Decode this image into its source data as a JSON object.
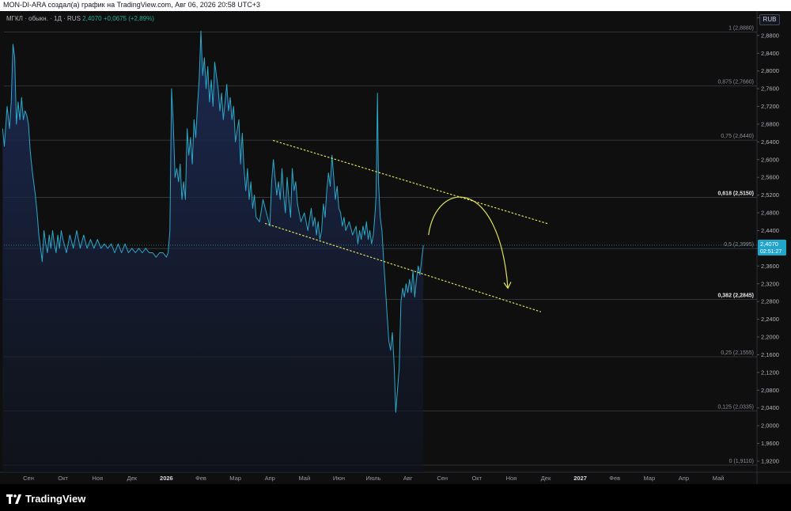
{
  "header": {
    "text": "MON-DI-ARA создал(а) график на TradingView.com, Авг 06, 2026 20:58 UTC+3"
  },
  "legend": {
    "symbol": "МГКЛ · обыкн. · 1Д · RUS",
    "price": "2,4070",
    "change": "+0,0675 (+2,89%)"
  },
  "currency": "RUB",
  "brand": {
    "logo_icon": "tradingview-logo-icon",
    "name": "TradingView"
  },
  "chart_data": {
    "type": "area",
    "title": "",
    "xlabel": "",
    "ylabel": "",
    "ylim": [
      1.895,
      2.935
    ],
    "price_tag": {
      "value": "2,4070",
      "countdown": "02:51:27",
      "y": 2.407
    },
    "y_ticks": [
      "1,9200",
      "1,9600",
      "2,0000",
      "2,0400",
      "2,0800",
      "2,1200",
      "2,1600",
      "2,2000",
      "2,2400",
      "2,2800",
      "2,3200",
      "2,3600",
      "2,4000",
      "2,4400",
      "2,4800",
      "2,5200",
      "2,5600",
      "2,6000",
      "2,6400",
      "2,6800",
      "2,7200",
      "2,7600",
      "2,8000",
      "2,8400",
      "2,8800",
      "2,9200"
    ],
    "y_tick_values": [
      1.92,
      1.96,
      2.0,
      2.04,
      2.08,
      2.12,
      2.16,
      2.2,
      2.24,
      2.28,
      2.32,
      2.36,
      2.4,
      2.44,
      2.48,
      2.52,
      2.56,
      2.6,
      2.64,
      2.68,
      2.72,
      2.76,
      2.8,
      2.84,
      2.88,
      2.92
    ],
    "x_ticks": [
      {
        "label": "Сен",
        "m": 0
      },
      {
        "label": "Окт",
        "m": 1
      },
      {
        "label": "Ноя",
        "m": 2
      },
      {
        "label": "Дек",
        "m": 3
      },
      {
        "label": "2026",
        "m": 4
      },
      {
        "label": "Фев",
        "m": 5
      },
      {
        "label": "Мар",
        "m": 6
      },
      {
        "label": "Апр",
        "m": 7
      },
      {
        "label": "Май",
        "m": 8
      },
      {
        "label": "Июн",
        "m": 9
      },
      {
        "label": "Июль",
        "m": 10
      },
      {
        "label": "Авг",
        "m": 11
      },
      {
        "label": "Сен",
        "m": 12
      },
      {
        "label": "Окт",
        "m": 13
      },
      {
        "label": "Ноя",
        "m": 14
      },
      {
        "label": "Дек",
        "m": 15
      },
      {
        "label": "2027",
        "m": 16
      },
      {
        "label": "Фев",
        "m": 17
      },
      {
        "label": "Мар",
        "m": 18
      },
      {
        "label": "Апр",
        "m": 19
      },
      {
        "label": "Май",
        "m": 20
      }
    ],
    "fib_levels": [
      {
        "label": "1 (2,8880)",
        "value": 2.888,
        "bold": false
      },
      {
        "label": "0,875 (2,7660)",
        "value": 2.766,
        "bold": false
      },
      {
        "label": "0,75 (2,6440)",
        "value": 2.644,
        "bold": false
      },
      {
        "label": "0,618 (2,5150)",
        "value": 2.515,
        "bold": true
      },
      {
        "label": "0,5 (2,3995)",
        "value": 2.3995,
        "bold": false
      },
      {
        "label": "0,382 (2,2845)",
        "value": 2.2845,
        "bold": true
      },
      {
        "label": "0,25 (2,1555)",
        "value": 2.1555,
        "bold": false
      },
      {
        "label": "0,125 (2,0335)",
        "value": 2.0335,
        "bold": false
      },
      {
        "label": "0 (1,9110)",
        "value": 1.911,
        "bold": false
      }
    ],
    "series": [
      {
        "color": "#2ca8c9",
        "points": [
          [
            -0.75,
            2.67
          ],
          [
            -0.7,
            2.63
          ],
          [
            -0.62,
            2.72
          ],
          [
            -0.55,
            2.67
          ],
          [
            -0.5,
            2.73
          ],
          [
            -0.45,
            2.86
          ],
          [
            -0.4,
            2.83
          ],
          [
            -0.35,
            2.68
          ],
          [
            -0.3,
            2.73
          ],
          [
            -0.25,
            2.69
          ],
          [
            -0.2,
            2.74
          ],
          [
            -0.15,
            2.69
          ],
          [
            -0.1,
            2.71
          ],
          [
            -0.05,
            2.7
          ],
          [
            0.0,
            2.68
          ],
          [
            0.05,
            2.62
          ],
          [
            0.1,
            2.58
          ],
          [
            0.15,
            2.55
          ],
          [
            0.2,
            2.52
          ],
          [
            0.25,
            2.48
          ],
          [
            0.3,
            2.43
          ],
          [
            0.35,
            2.4
          ],
          [
            0.4,
            2.37
          ],
          [
            0.45,
            2.44
          ],
          [
            0.5,
            2.41
          ],
          [
            0.55,
            2.39
          ],
          [
            0.6,
            2.43
          ],
          [
            0.65,
            2.4
          ],
          [
            0.7,
            2.44
          ],
          [
            0.75,
            2.41
          ],
          [
            0.8,
            2.39
          ],
          [
            0.85,
            2.43
          ],
          [
            0.9,
            2.4
          ],
          [
            0.95,
            2.44
          ],
          [
            1.0,
            2.42
          ],
          [
            1.1,
            2.39
          ],
          [
            1.2,
            2.43
          ],
          [
            1.3,
            2.4
          ],
          [
            1.4,
            2.44
          ],
          [
            1.5,
            2.4
          ],
          [
            1.6,
            2.43
          ],
          [
            1.7,
            2.4
          ],
          [
            1.8,
            2.42
          ],
          [
            1.9,
            2.4
          ],
          [
            2.0,
            2.42
          ],
          [
            2.1,
            2.4
          ],
          [
            2.2,
            2.41
          ],
          [
            2.3,
            2.4
          ],
          [
            2.4,
            2.41
          ],
          [
            2.5,
            2.39
          ],
          [
            2.6,
            2.41
          ],
          [
            2.7,
            2.39
          ],
          [
            2.8,
            2.41
          ],
          [
            2.9,
            2.39
          ],
          [
            3.0,
            2.4
          ],
          [
            3.1,
            2.39
          ],
          [
            3.2,
            2.4
          ],
          [
            3.3,
            2.39
          ],
          [
            3.4,
            2.4
          ],
          [
            3.5,
            2.39
          ],
          [
            3.6,
            2.39
          ],
          [
            3.7,
            2.38
          ],
          [
            3.8,
            2.39
          ],
          [
            3.9,
            2.39
          ],
          [
            4.0,
            2.38
          ],
          [
            4.05,
            2.39
          ],
          [
            4.1,
            2.44
          ],
          [
            4.15,
            2.76
          ],
          [
            4.2,
            2.68
          ],
          [
            4.25,
            2.56
          ],
          [
            4.3,
            2.58
          ],
          [
            4.35,
            2.55
          ],
          [
            4.4,
            2.59
          ],
          [
            4.45,
            2.51
          ],
          [
            4.5,
            2.55
          ],
          [
            4.55,
            2.51
          ],
          [
            4.6,
            2.67
          ],
          [
            4.65,
            2.61
          ],
          [
            4.7,
            2.65
          ],
          [
            4.75,
            2.59
          ],
          [
            4.8,
            2.69
          ],
          [
            4.85,
            2.65
          ],
          [
            4.9,
            2.72
          ],
          [
            4.95,
            2.78
          ],
          [
            5.0,
            2.89
          ],
          [
            5.05,
            2.79
          ],
          [
            5.1,
            2.83
          ],
          [
            5.15,
            2.76
          ],
          [
            5.2,
            2.81
          ],
          [
            5.25,
            2.73
          ],
          [
            5.3,
            2.78
          ],
          [
            5.35,
            2.72
          ],
          [
            5.4,
            2.82
          ],
          [
            5.45,
            2.79
          ],
          [
            5.5,
            2.76
          ],
          [
            5.55,
            2.71
          ],
          [
            5.6,
            2.75
          ],
          [
            5.65,
            2.69
          ],
          [
            5.7,
            2.73
          ],
          [
            5.75,
            2.77
          ],
          [
            5.8,
            2.71
          ],
          [
            5.85,
            2.74
          ],
          [
            5.9,
            2.69
          ],
          [
            5.95,
            2.72
          ],
          [
            6.0,
            2.64
          ],
          [
            6.1,
            2.69
          ],
          [
            6.15,
            2.59
          ],
          [
            6.2,
            2.66
          ],
          [
            6.25,
            2.58
          ],
          [
            6.3,
            2.53
          ],
          [
            6.35,
            2.58
          ],
          [
            6.4,
            2.51
          ],
          [
            6.45,
            2.55
          ],
          [
            6.5,
            2.49
          ],
          [
            6.55,
            2.52
          ],
          [
            6.6,
            2.47
          ],
          [
            6.7,
            2.46
          ],
          [
            6.8,
            2.51
          ],
          [
            6.9,
            2.48
          ],
          [
            7.0,
            2.45
          ],
          [
            7.05,
            2.55
          ],
          [
            7.1,
            2.6
          ],
          [
            7.15,
            2.56
          ],
          [
            7.2,
            2.52
          ],
          [
            7.25,
            2.55
          ],
          [
            7.3,
            2.51
          ],
          [
            7.35,
            2.58
          ],
          [
            7.4,
            2.52
          ],
          [
            7.45,
            2.48
          ],
          [
            7.5,
            2.56
          ],
          [
            7.55,
            2.51
          ],
          [
            7.6,
            2.47
          ],
          [
            7.65,
            2.58
          ],
          [
            7.7,
            2.53
          ],
          [
            7.75,
            2.55
          ],
          [
            7.8,
            2.5
          ],
          [
            7.9,
            2.46
          ],
          [
            8.0,
            2.48
          ],
          [
            8.1,
            2.44
          ],
          [
            8.2,
            2.49
          ],
          [
            8.25,
            2.45
          ],
          [
            8.3,
            2.47
          ],
          [
            8.35,
            2.43
          ],
          [
            8.4,
            2.46
          ],
          [
            8.45,
            2.42
          ],
          [
            8.5,
            2.44
          ],
          [
            8.55,
            2.5
          ],
          [
            8.6,
            2.47
          ],
          [
            8.65,
            2.53
          ],
          [
            8.7,
            2.57
          ],
          [
            8.75,
            2.54
          ],
          [
            8.8,
            2.61
          ],
          [
            8.85,
            2.56
          ],
          [
            8.9,
            2.51
          ],
          [
            8.95,
            2.54
          ],
          [
            9.0,
            2.49
          ],
          [
            9.05,
            2.48
          ],
          [
            9.1,
            2.45
          ],
          [
            9.15,
            2.47
          ],
          [
            9.2,
            2.44
          ],
          [
            9.3,
            2.46
          ],
          [
            9.4,
            2.43
          ],
          [
            9.5,
            2.45
          ],
          [
            9.55,
            2.41
          ],
          [
            9.6,
            2.44
          ],
          [
            9.65,
            2.42
          ],
          [
            9.7,
            2.45
          ],
          [
            9.75,
            2.43
          ],
          [
            9.8,
            2.46
          ],
          [
            9.85,
            2.42
          ],
          [
            9.9,
            2.44
          ],
          [
            9.95,
            2.41
          ],
          [
            10.0,
            2.43
          ],
          [
            10.05,
            2.48
          ],
          [
            10.08,
            2.52
          ],
          [
            10.12,
            2.75
          ],
          [
            10.15,
            2.55
          ],
          [
            10.2,
            2.47
          ],
          [
            10.25,
            2.44
          ],
          [
            10.3,
            2.37
          ],
          [
            10.35,
            2.31
          ],
          [
            10.4,
            2.25
          ],
          [
            10.45,
            2.19
          ],
          [
            10.5,
            2.17
          ],
          [
            10.55,
            2.21
          ],
          [
            10.6,
            2.14
          ],
          [
            10.62,
            2.1
          ],
          [
            10.65,
            2.03
          ],
          [
            10.7,
            2.08
          ],
          [
            10.75,
            2.13
          ],
          [
            10.8,
            2.28
          ],
          [
            10.85,
            2.31
          ],
          [
            10.9,
            2.29
          ],
          [
            10.95,
            2.32
          ],
          [
            11.0,
            2.3
          ],
          [
            11.05,
            2.33
          ],
          [
            11.1,
            2.3
          ],
          [
            11.15,
            2.35
          ],
          [
            11.2,
            2.29
          ],
          [
            11.25,
            2.33
          ],
          [
            11.3,
            2.36
          ],
          [
            11.35,
            2.34
          ],
          [
            11.45,
            2.407
          ]
        ]
      }
    ],
    "annotations": [
      {
        "type": "dotted-line",
        "color": "#e3e35a",
        "from": [
          7.1,
          2.643
        ],
        "to": [
          15.08,
          2.455
        ]
      },
      {
        "type": "dotted-line",
        "color": "#e3e35a",
        "from": [
          6.87,
          2.456
        ],
        "to": [
          14.85,
          2.257
        ]
      },
      {
        "type": "curved-arrow",
        "color": "#e3e35a",
        "from": [
          11.6,
          2.43
        ],
        "peak": [
          12.5,
          2.52
        ],
        "to": [
          13.9,
          2.31
        ]
      }
    ]
  }
}
